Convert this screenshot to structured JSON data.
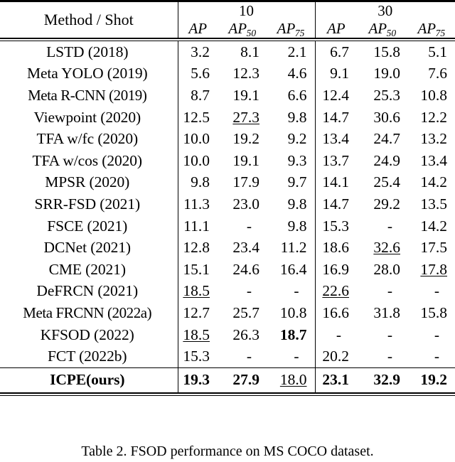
{
  "table": {
    "corner_label": "Method / Shot",
    "shot_groups": [
      {
        "label": "10",
        "metrics": [
          "AP",
          "AP50",
          "AP75"
        ]
      },
      {
        "label": "30",
        "metrics": [
          "AP",
          "AP50",
          "AP75"
        ]
      }
    ],
    "metric_labels": {
      "ap": "AP",
      "ap50_base": "AP",
      "ap50_sub": "50",
      "ap75_base": "AP",
      "ap75_sub": "75"
    },
    "rows": [
      {
        "method": "LSTD (2018)",
        "v": [
          "3.2",
          "8.1",
          "2.1",
          "6.7",
          "15.8",
          "5.1"
        ],
        "style": [
          "",
          "",
          "",
          "",
          "",
          ""
        ]
      },
      {
        "method": "Meta YOLO (2019)",
        "v": [
          "5.6",
          "12.3",
          "4.6",
          "9.1",
          "19.0",
          "7.6"
        ],
        "style": [
          "",
          "",
          "",
          "",
          "",
          ""
        ]
      },
      {
        "method": "Meta R-CNN (2019)",
        "v": [
          "8.7",
          "19.1",
          "6.6",
          "12.4",
          "25.3",
          "10.8"
        ],
        "style": [
          "",
          "",
          "",
          "",
          "",
          ""
        ]
      },
      {
        "method": "Viewpoint (2020)",
        "v": [
          "12.5",
          "27.3",
          "9.8",
          "14.7",
          "30.6",
          "12.2"
        ],
        "style": [
          "",
          "ul",
          "",
          "",
          "",
          ""
        ]
      },
      {
        "method": "TFA w/fc (2020)",
        "v": [
          "10.0",
          "19.2",
          "9.2",
          "13.4",
          "24.7",
          "13.2"
        ],
        "style": [
          "",
          "",
          "",
          "",
          "",
          ""
        ]
      },
      {
        "method": "TFA w/cos (2020)",
        "v": [
          "10.0",
          "19.1",
          "9.3",
          "13.7",
          "24.9",
          "13.4"
        ],
        "style": [
          "",
          "",
          "",
          "",
          "",
          ""
        ]
      },
      {
        "method": "MPSR (2020)",
        "v": [
          "9.8",
          "17.9",
          "9.7",
          "14.1",
          "25.4",
          "14.2"
        ],
        "style": [
          "",
          "",
          "",
          "",
          "",
          ""
        ]
      },
      {
        "method": "SRR-FSD (2021)",
        "v": [
          "11.3",
          "23.0",
          "9.8",
          "14.7",
          "29.2",
          "13.5"
        ],
        "style": [
          "",
          "",
          "",
          "",
          "",
          ""
        ]
      },
      {
        "method": "FSCE (2021)",
        "v": [
          "11.1",
          "-",
          "9.8",
          "15.3",
          "-",
          "14.2"
        ],
        "style": [
          "",
          "",
          "",
          "",
          "",
          ""
        ]
      },
      {
        "method": "DCNet (2021)",
        "v": [
          "12.8",
          "23.4",
          "11.2",
          "18.6",
          "32.6",
          "17.5"
        ],
        "style": [
          "",
          "",
          "",
          "",
          "ul",
          ""
        ]
      },
      {
        "method": "CME (2021)",
        "v": [
          "15.1",
          "24.6",
          "16.4",
          "16.9",
          "28.0",
          "17.8"
        ],
        "style": [
          "",
          "",
          "",
          "",
          "",
          "ul"
        ]
      },
      {
        "method": "DeFRCN (2021)",
        "v": [
          "18.5",
          "-",
          "-",
          "22.6",
          "-",
          "-"
        ],
        "style": [
          "ul",
          "",
          "",
          "ul",
          "",
          ""
        ]
      },
      {
        "method": "Meta FRCNN (2022a)",
        "v": [
          "12.7",
          "25.7",
          "10.8",
          "16.6",
          "31.8",
          "15.8"
        ],
        "style": [
          "",
          "",
          "",
          "",
          "",
          ""
        ]
      },
      {
        "method": "KFSOD (2022)",
        "v": [
          "18.5",
          "26.3",
          "18.7",
          "-",
          "-",
          "-"
        ],
        "style": [
          "ul",
          "",
          "bold",
          "",
          "",
          ""
        ]
      },
      {
        "method": "FCT (2022b)",
        "v": [
          "15.3",
          "-",
          "-",
          "20.2",
          "-",
          "-"
        ],
        "style": [
          "",
          "",
          "",
          "",
          "",
          ""
        ]
      }
    ],
    "final_row": {
      "method": "ICPE(ours)",
      "v": [
        "19.3",
        "27.9",
        "18.0",
        "23.1",
        "32.9",
        "19.2"
      ],
      "style": [
        "bold",
        "bold",
        "ul",
        "bold",
        "bold",
        "bold"
      ]
    }
  },
  "caption": {
    "text": "Table 2. FSOD performance on MS COCO dataset."
  }
}
